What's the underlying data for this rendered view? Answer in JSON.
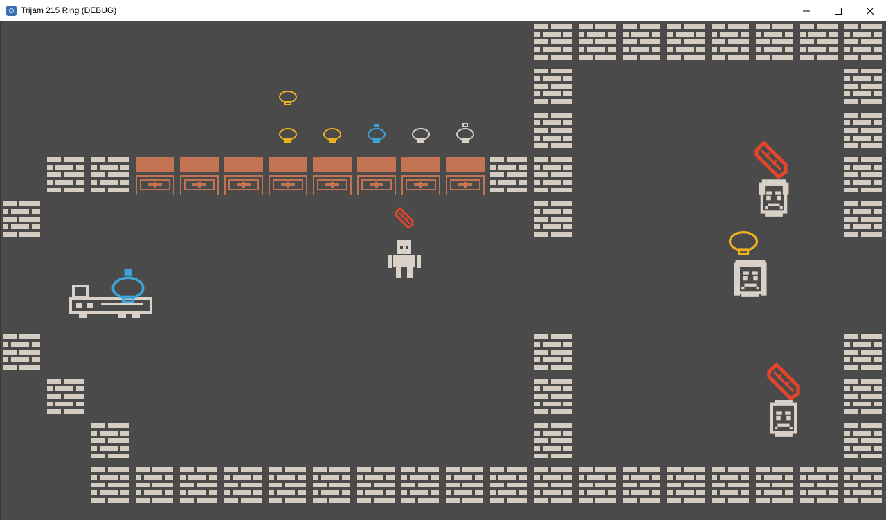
{
  "window": {
    "title": "Trijam 215 Ring (DEBUG)",
    "icon": "godot-engine-icon",
    "controls": [
      "minimize-icon",
      "maximize-icon",
      "close-icon"
    ]
  },
  "palette": {
    "background": "#4a4a4a",
    "brick": "#d6cdc2",
    "counter": "#c27352",
    "gold": "#eeb11f",
    "blue": "#3ba4d9",
    "silver": "#d9d1c7",
    "red": "#e3452b",
    "character": "#d9d1c7"
  },
  "scene": {
    "counter_panels": 8,
    "rings_on_display": [
      "gold-ring",
      "gold-ring",
      "gold-ring",
      "blue-gem-ring",
      "silver-ring",
      "diamond-ring"
    ],
    "npcs": [
      {
        "name": "grumpy-villager",
        "wants": "red-crystal"
      },
      {
        "name": "long-haired-villager",
        "wants": "gold-ring"
      },
      {
        "name": "bald-villager",
        "wants": "red-crystal"
      }
    ],
    "player": {
      "name": "shopkeeper",
      "holding": "red-crystal"
    },
    "cart": {
      "name": "wagon",
      "carrying": "blue-gem-ring"
    }
  }
}
